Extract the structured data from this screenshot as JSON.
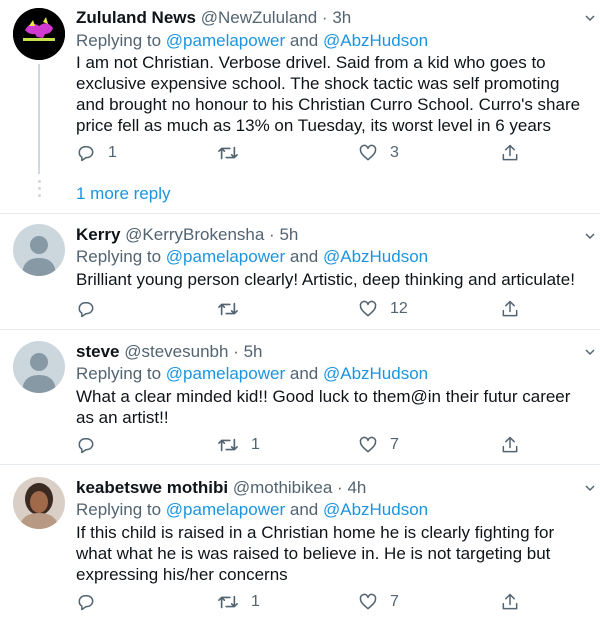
{
  "tweets": [
    {
      "name": "Zululand News",
      "handle": "@NewZululand",
      "dot": "·",
      "time": "3h",
      "replying_prefix": "Replying to",
      "mention1": "@pamelapower",
      "and": "and",
      "mention2": "@AbzHudson",
      "text": "I am not Christian. Verbose drivel. Said from a kid who goes to exclusive expensive school. The shock tactic was self promoting and brought no honour to his Christian Curro School. Curro's share price fell as much as 13% on Tuesday, its worst level in 6 years",
      "reply_count": "1",
      "retweet_count": "",
      "like_count": "3",
      "logo_text": "Zululand News"
    },
    {
      "name": "Kerry",
      "handle": "@KerryBrokensha",
      "dot": "·",
      "time": "5h",
      "replying_prefix": "Replying to",
      "mention1": "@pamelapower",
      "and": "and",
      "mention2": "@AbzHudson",
      "text": "Brilliant young person clearly! Artistic, deep thinking and articulate!",
      "reply_count": "",
      "retweet_count": "",
      "like_count": "12"
    },
    {
      "name": "steve",
      "handle": "@stevesunbh",
      "dot": "·",
      "time": "5h",
      "replying_prefix": "Replying to",
      "mention1": "@pamelapower",
      "and": "and",
      "mention2": "@AbzHudson",
      "text": "What a clear minded kid!! Good luck to them@in their futur career as an artist!!",
      "reply_count": "",
      "retweet_count": "1",
      "like_count": "7"
    },
    {
      "name": "keabetswe mothibi",
      "handle": "@mothibikea",
      "dot": "·",
      "time": "4h",
      "replying_prefix": "Replying to",
      "mention1": "@pamelapower",
      "and": "and",
      "mention2": "@AbzHudson",
      "text": "If this child is raised in a Christian home he is clearly fighting for what what he is was raised to believe in. He is not targeting but expressing his/her concerns",
      "reply_count": "",
      "retweet_count": "1",
      "like_count": "7"
    }
  ],
  "more_replies_label": "1 more reply",
  "icons": {
    "reply": "reply-icon",
    "retweet": "retweet-icon",
    "like": "like-icon",
    "share": "share-icon",
    "more": "chevron-down-icon"
  },
  "colors": {
    "link": "#1b95e0",
    "muted": "#536471",
    "divider": "#e6ecf0"
  }
}
